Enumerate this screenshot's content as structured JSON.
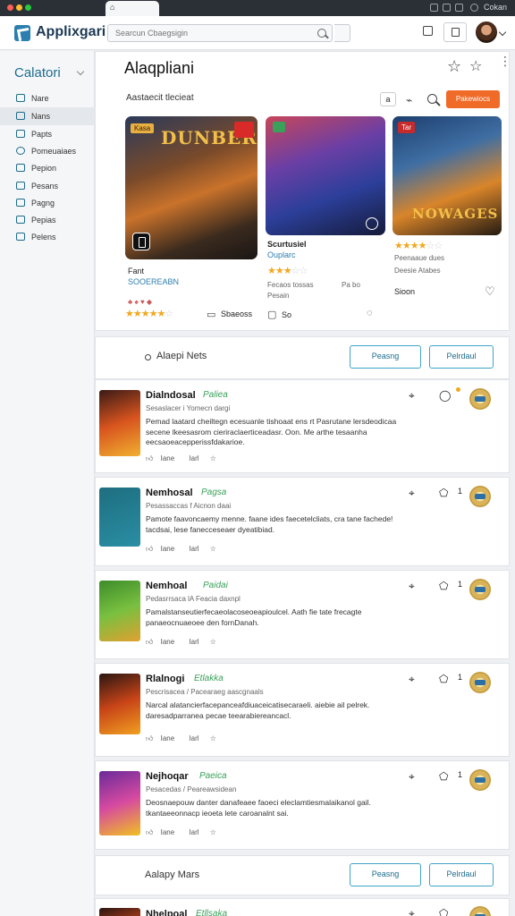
{
  "window": {
    "tab_label": "",
    "right_label": "Cokan",
    "traffic_colors": [
      "#ff5f57",
      "#febc2e",
      "#28c840"
    ]
  },
  "appbar": {
    "logo_text": "Applixgari",
    "search_placeholder": "Searcun Cbaegsigin"
  },
  "sidebar": {
    "title": "Calatori",
    "items": [
      {
        "label": "Nare",
        "active": false
      },
      {
        "label": "Nans",
        "active": true
      },
      {
        "label": "Papts",
        "active": false
      },
      {
        "label": "Pomeuaiaes",
        "active": false
      },
      {
        "label": "Pepion",
        "active": false
      },
      {
        "label": "Pesans",
        "active": false
      },
      {
        "label": "Pagng",
        "active": false
      },
      {
        "label": "Pepias",
        "active": false
      },
      {
        "label": "Pelens",
        "active": false
      }
    ]
  },
  "featured": {
    "title": "Alaqpliani",
    "subhead": "Aastaecit tlecieat",
    "chip_text": "a",
    "cta_label": "Pakewiocs",
    "games": [
      {
        "art_title": "DUNBER",
        "badge": "Kasa",
        "name": "Fant",
        "tagline": "SOOEREABN",
        "rating": 4.5,
        "action_label": "Sbaeoss"
      },
      {
        "art_title": "",
        "name": "Scurtusiel",
        "tagline": "Ouplarc",
        "rating": 3.5,
        "meta_left": "Fecaos tossas",
        "meta_right": "Pa bo",
        "meta_line": "Pesain",
        "action_label": "So"
      },
      {
        "art_title": "NOWAGES",
        "badge": "Tar",
        "rating": 3.5,
        "meta_line1": "Peenaaue dues",
        "meta_line2": "Deesie Atabes",
        "price": "Sioon"
      }
    ]
  },
  "section1": {
    "title": "Alaepi Nets",
    "btn_primary": "Peasng",
    "btn_secondary": "Pelrdaul"
  },
  "reviews": [
    {
      "name": "Dialndosal",
      "tag": "Paliea",
      "sub": "Sesaslacer i Yomecn dargi",
      "text": "Pemad laatard cheiltegn ecesuanle tishoaat ens rt Pasrutane lersdeodicaa secene lkeesasrom cieriraclaerticeadasr. Oon. Me arthe tesaanha eecsaoeacepperissfdakarioe.",
      "a1": "Iane",
      "a2": "Iarl",
      "count": "",
      "colors": [
        "#3a1a16",
        "#d8541e",
        "#f0b030"
      ]
    },
    {
      "name": "Nemhosal",
      "tag": "Pagsa",
      "sub": "Pesassaccas f Aicnon daai",
      "text": "Pamote faavoncaemy menne. faane ides faecetelcliats, cra tane fachede! tacdsai, lese fanecceseaer dyeatibiad.",
      "a1": "Iane",
      "a2": "Iarl",
      "count": "1",
      "colors": [
        "#1e6e80",
        "#2a8ea3",
        "#e8f4f6"
      ]
    },
    {
      "name": "Nemhoal",
      "tag": "Paidai",
      "sub": "Pedasrrsaca lA Feacia daxnpl",
      "text": "Pamalstanseutierfecaeolacoseoeapioulcel. Aath fie tate frecagte panaeocnuaeoee den fornDanah.",
      "a1": "Iane",
      "a2": "Iarl",
      "count": "1",
      "colors": [
        "#3c8c2a",
        "#79c040",
        "#e0a030"
      ]
    },
    {
      "name": "Rlalnogi",
      "tag": "Etlakka",
      "sub": "Pescrisacea / Pacearaeg aascgnaals",
      "text": "Narcal alatancierfacepanceafdiuaceicatisecaraeli. aiebie ail pelrek. daresadparranea pecae teearabiereancacl.",
      "a1": "Iane",
      "a2": "Iarl",
      "count": "1",
      "colors": [
        "#2a1612",
        "#c84418",
        "#f0a020"
      ]
    },
    {
      "name": "Nejhoqar",
      "tag": "Paeica",
      "sub": "Pesacedas / Peareawsidean",
      "text": "Deosnaepouw danter danafeaee faoeci eleclamtiesmalaikanol gail. tkantaeeonnacp ieoeta lete caroanalnt sai.",
      "a1": "Iane",
      "a2": "Iarl",
      "count": "1",
      "colors": [
        "#6a2a9a",
        "#d64aa0",
        "#f0c020"
      ]
    }
  ],
  "section2": {
    "title": "Aalapy Mars",
    "btn_primary": "Peasng",
    "btn_secondary": "Pelrdaul"
  },
  "partial": {
    "name": "Nhelpoal",
    "tag": "Etllsaka"
  }
}
